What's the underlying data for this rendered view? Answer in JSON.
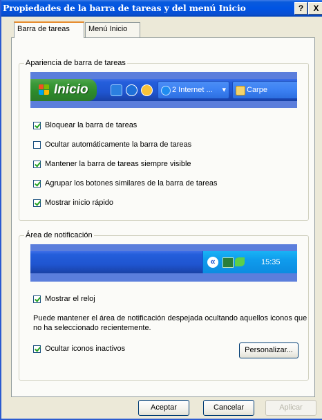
{
  "window": {
    "title": "Propiedades de la barra de tareas y del menú Inicio",
    "help_label": "?",
    "close_label": "X"
  },
  "tabs": [
    {
      "label": "Barra de tareas",
      "active": true
    },
    {
      "label": "Menú Inicio",
      "active": false
    }
  ],
  "taskbar_group": {
    "legend": "Apariencia de barra de tareas",
    "preview": {
      "start_label": "Inicio",
      "items": [
        {
          "label": "2 Internet ...",
          "icon": "internet-explorer-icon",
          "dropdown": "▾"
        },
        {
          "label": "Carpe",
          "icon": "folder-icon"
        }
      ]
    },
    "options": [
      {
        "label": "Bloquear la barra de tareas",
        "checked": true
      },
      {
        "label": "Ocultar automáticamente la barra de tareas",
        "checked": false
      },
      {
        "label": "Mantener la barra de tareas siempre visible",
        "checked": true
      },
      {
        "label": "Agrupar los botones similares de la barra de tareas",
        "checked": true
      },
      {
        "label": "Mostrar inicio rápido",
        "checked": true
      }
    ]
  },
  "notification_group": {
    "legend": "Área de notificación",
    "clock": "15:35",
    "expand_glyph": "«",
    "show_clock_label": "Mostrar el reloj",
    "show_clock_checked": true,
    "description": "Puede mantener el área de notificación despejada ocultando aquellos iconos que no ha seleccionado recientemente.",
    "hide_inactive_label": "Ocultar iconos inactivos",
    "hide_inactive_checked": true,
    "customize_label": "Personalizar..."
  },
  "buttons": {
    "ok": "Aceptar",
    "cancel": "Cancelar",
    "apply": "Aplicar"
  },
  "colors": {
    "title_bar": "#0054e3",
    "start_button": "#3c9a3a",
    "taskbar": "#245edb",
    "tray": "#0f9bec",
    "dialog_bg": "#ece9d8"
  }
}
